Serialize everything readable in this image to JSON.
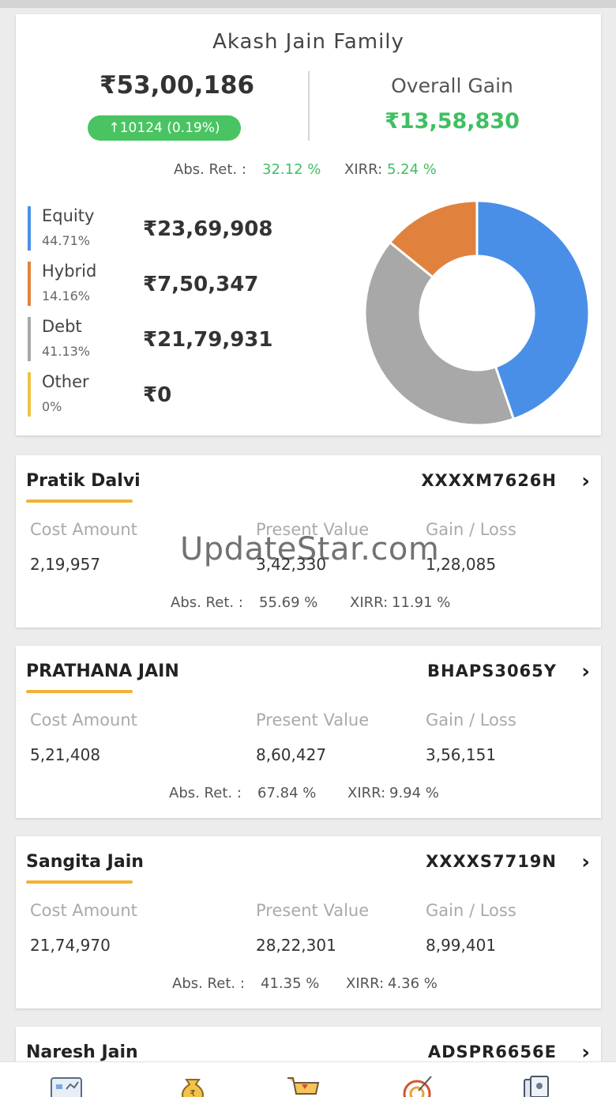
{
  "summary": {
    "family_name": "Akash Jain Family",
    "total_value": "₹53,00,186",
    "day_change": "↑10124 (0.19%)",
    "overall_gain_label": "Overall Gain",
    "overall_gain": "₹13,58,830",
    "abs_ret_label": "Abs. Ret. :",
    "abs_ret": "32.12 %",
    "xirr_label": "XIRR:",
    "xirr": "5.24 %"
  },
  "allocation": [
    {
      "name": "Equity",
      "pct": "44.71%",
      "amount": "₹23,69,908",
      "color": "#4a8fe7",
      "share": 44.71
    },
    {
      "name": "Hybrid",
      "pct": "14.16%",
      "amount": "₹7,50,347",
      "color": "#e0823e",
      "share": 14.16
    },
    {
      "name": "Debt",
      "pct": "41.13%",
      "amount": "₹21,79,931",
      "color": "#a8a8a8",
      "share": 41.13
    },
    {
      "name": "Other",
      "pct": "0%",
      "amount": "₹0",
      "color": "#f0c24a",
      "share": 0
    }
  ],
  "labels": {
    "cost": "Cost Amount",
    "present": "Present Value",
    "gain": "Gain / Loss",
    "abs_ret": "Abs. Ret. :",
    "xirr": "XIRR:"
  },
  "members": [
    {
      "name": "Pratik Dalvi",
      "pan": "XXXXM7626H",
      "cost": "2,19,957",
      "present": "3,42,330",
      "gain": "1,28,085",
      "abs_ret": "55.69 %",
      "xirr": "11.91 %"
    },
    {
      "name": "PRATHANA JAIN",
      "pan": "BHAPS3065Y",
      "cost": "5,21,408",
      "present": "8,60,427",
      "gain": "3,56,151",
      "abs_ret": "67.84 %",
      "xirr": "9.94 %"
    },
    {
      "name": "Sangita Jain",
      "pan": "XXXXS7719N",
      "cost": "21,74,970",
      "present": "28,22,301",
      "gain": "8,99,401",
      "abs_ret": "41.35 %",
      "xirr": "4.36 %"
    },
    {
      "name": "Naresh Jain",
      "pan": "ADSPR6656E"
    }
  ],
  "watermark": "UpdateStar.com",
  "nav_icons": [
    "dashboard-icon",
    "money-bag-icon",
    "cart-icon",
    "target-icon",
    "documents-icon"
  ]
}
